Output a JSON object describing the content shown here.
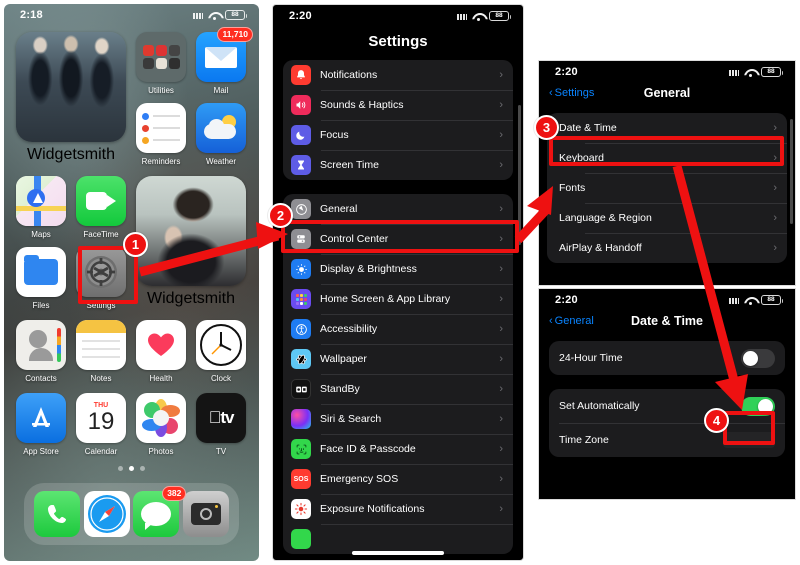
{
  "colors": {
    "accent_red": "#ee1111",
    "ios_blue": "#0a84ff",
    "toggle_on": "#30d158",
    "toggle_off": "#3a3a3c",
    "badge_red": "#ff2e21"
  },
  "home_screen": {
    "status": {
      "time": "2:18",
      "battery": "88",
      "cellular_icon": "cellular-icon",
      "wifi_icon": "wifi-icon",
      "battery_icon": "battery-icon"
    },
    "widgets": [
      {
        "name": "Widgetsmith",
        "label": "Widgetsmith"
      },
      {
        "name": "Widgetsmith",
        "label": "Widgetsmith"
      }
    ],
    "apps_row1": [
      {
        "label": "Utilities",
        "icon": "folder-icon",
        "badge": ""
      },
      {
        "label": "Mail",
        "icon": "mail-icon",
        "badge": "11,710"
      }
    ],
    "apps_row2": [
      {
        "label": "Reminders",
        "icon": "reminders-icon",
        "badge": ""
      },
      {
        "label": "Weather",
        "icon": "weather-icon",
        "badge": ""
      }
    ],
    "apps_row3": [
      {
        "label": "Maps",
        "icon": "maps-icon",
        "badge": ""
      },
      {
        "label": "FaceTime",
        "icon": "facetime-icon",
        "badge": ""
      }
    ],
    "apps_row4": [
      {
        "label": "Files",
        "icon": "files-icon",
        "badge": ""
      },
      {
        "label": "Settings",
        "icon": "settings-gear-icon",
        "badge": ""
      }
    ],
    "apps_row5": [
      {
        "label": "Contacts",
        "icon": "contacts-icon",
        "badge": ""
      },
      {
        "label": "Notes",
        "icon": "notes-icon",
        "badge": ""
      },
      {
        "label": "Health",
        "icon": "health-heart-icon",
        "badge": ""
      },
      {
        "label": "Clock",
        "icon": "clock-icon",
        "badge": ""
      }
    ],
    "apps_row6": [
      {
        "label": "App Store",
        "icon": "appstore-icon",
        "badge": ""
      },
      {
        "label": "Calendar",
        "icon": "calendar-icon",
        "badge": "",
        "day_name": "THU",
        "day_num": "19"
      },
      {
        "label": "Photos",
        "icon": "photos-icon",
        "badge": ""
      },
      {
        "label": "TV",
        "icon": "appletv-icon",
        "badge": ""
      }
    ],
    "dock": [
      {
        "label": "Phone",
        "icon": "phone-icon",
        "badge": ""
      },
      {
        "label": "Safari",
        "icon": "safari-compass-icon",
        "badge": ""
      },
      {
        "label": "Messages",
        "icon": "messages-bubble-icon",
        "badge": "382"
      },
      {
        "label": "Camera",
        "icon": "camera-icon",
        "badge": ""
      }
    ],
    "page_dots": 3,
    "active_dot": 2
  },
  "settings_screen": {
    "status": {
      "time": "2:20",
      "battery": "88"
    },
    "title": "Settings",
    "group1": [
      {
        "label": "Notifications",
        "icon": "notifications-bell-icon",
        "color": "#ff3b30"
      },
      {
        "label": "Sounds & Haptics",
        "icon": "sounds-speaker-icon",
        "color": "#ef2b5b"
      },
      {
        "label": "Focus",
        "icon": "focus-moon-icon",
        "color": "#5e5ce6"
      },
      {
        "label": "Screen Time",
        "icon": "screentime-hourglass-icon",
        "color": "#5e5ce6"
      }
    ],
    "group2": [
      {
        "label": "General",
        "icon": "general-gear-icon",
        "color": "#8e8e93"
      },
      {
        "label": "Control Center",
        "icon": "controlcenter-icon",
        "color": "#8e8e93"
      },
      {
        "label": "Display & Brightness",
        "icon": "display-brightness-icon",
        "color": "#1f7cf2"
      },
      {
        "label": "Home Screen & App Library",
        "icon": "home-screen-icon",
        "color": "#6a4cf0"
      },
      {
        "label": "Accessibility",
        "icon": "accessibility-icon",
        "color": "#1f7cf2"
      },
      {
        "label": "Wallpaper",
        "icon": "wallpaper-icon",
        "color": "#5ec8f5"
      },
      {
        "label": "StandBy",
        "icon": "standby-icon",
        "color": "#111111"
      },
      {
        "label": "Siri & Search",
        "icon": "siri-icon",
        "color": "#5d2f8d"
      },
      {
        "label": "Face ID & Passcode",
        "icon": "faceid-icon",
        "color": "#32d74b"
      },
      {
        "label": "Emergency SOS",
        "icon": "emergency-sos-icon",
        "color": "#ff3b30"
      },
      {
        "label": "Exposure Notifications",
        "icon": "exposure-notifications-icon",
        "color": "#ffffff"
      }
    ],
    "chevron": "›"
  },
  "general_screen": {
    "status": {
      "time": "2:20",
      "battery": "88"
    },
    "back_label": "Settings",
    "title": "General",
    "rows": [
      {
        "label": "Date & Time"
      },
      {
        "label": "Keyboard"
      },
      {
        "label": "Fonts"
      },
      {
        "label": "Language & Region"
      },
      {
        "label": "AirPlay & Handoff"
      }
    ],
    "chevron": "›"
  },
  "datetime_screen": {
    "status": {
      "time": "2:20",
      "battery": "88"
    },
    "back_label": "General",
    "title": "Date & Time",
    "rows": [
      {
        "label": "24-Hour Time",
        "type": "toggle",
        "state": "off"
      },
      {
        "label": "Set Automatically",
        "type": "toggle",
        "state": "on"
      },
      {
        "label": "Time Zone",
        "type": "value",
        "state": ""
      }
    ]
  },
  "annotations": {
    "steps": [
      {
        "number": "1",
        "target": "settings-app-icon"
      },
      {
        "number": "2",
        "target": "general-settings-row"
      },
      {
        "number": "3",
        "target": "date-and-time-row"
      },
      {
        "number": "4",
        "target": "set-automatically-toggle"
      }
    ]
  }
}
